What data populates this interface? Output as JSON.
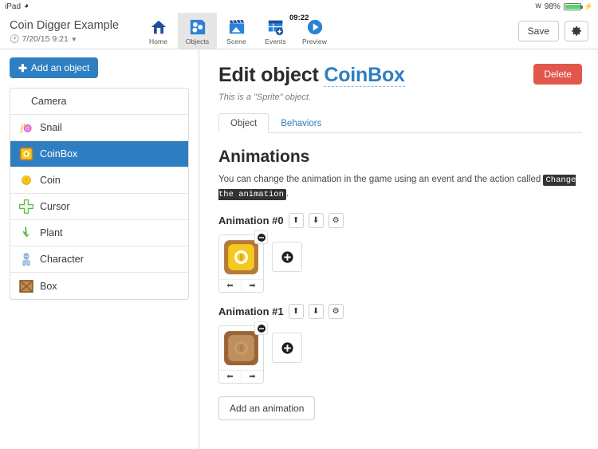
{
  "status_bar": {
    "device": "iPad",
    "wifi_icon": "wifi-icon",
    "bluetooth_icon": "bluetooth-icon",
    "battery_percent": "98%",
    "battery_level": 98,
    "charging_icon": "charging-bolt-icon"
  },
  "topbar": {
    "project_title": "Coin Digger Example",
    "project_date": "7/20/15 9:21",
    "clock_icon": "clock-icon",
    "dropdown_icon": "chevron-down-icon",
    "time": "09:22",
    "save_label": "Save",
    "settings_icon": "gear-icon",
    "tabs": [
      {
        "label": "Home",
        "icon": "home-icon",
        "active": false
      },
      {
        "label": "Objects",
        "icon": "objects-icon",
        "active": true
      },
      {
        "label": "Scene",
        "icon": "scene-clapperboard-icon",
        "active": false
      },
      {
        "label": "Events",
        "icon": "events-icon",
        "active": false
      },
      {
        "label": "Preview",
        "icon": "play-icon",
        "active": false
      }
    ]
  },
  "sidebar": {
    "add_object_label": "Add an object",
    "add_icon": "plus-icon",
    "items": [
      {
        "label": "Camera",
        "icon": "none",
        "selected": false
      },
      {
        "label": "Snail",
        "icon": "snail-icon",
        "selected": false
      },
      {
        "label": "CoinBox",
        "icon": "coinbox-icon",
        "selected": true
      },
      {
        "label": "Coin",
        "icon": "coin-icon",
        "selected": false
      },
      {
        "label": "Cursor",
        "icon": "cursor-cross-icon",
        "selected": false
      },
      {
        "label": "Plant",
        "icon": "plant-icon",
        "selected": false
      },
      {
        "label": "Character",
        "icon": "character-icon",
        "selected": false
      },
      {
        "label": "Box",
        "icon": "box-icon",
        "selected": false
      }
    ]
  },
  "main": {
    "title_prefix": "Edit object ",
    "object_name": "CoinBox",
    "delete_label": "Delete",
    "sprite_note": "This is a \"Sprite\" object.",
    "tabs": [
      {
        "label": "Object",
        "active": true
      },
      {
        "label": "Behaviors",
        "active": false
      }
    ],
    "animations_heading": "Animations",
    "description_before": "You can change the animation in the game using an event and the action called ",
    "description_code": "Change the animation",
    "description_after": ".",
    "move_up_icon": "arrow-up-icon",
    "move_down_icon": "arrow-down-icon",
    "settings_icon": "gear-icon",
    "remove_icon": "remove-circle-icon",
    "add_frame_icon": "plus-circle-icon",
    "frame_prev_icon": "arrow-left-icon",
    "frame_next_icon": "arrow-right-icon",
    "animations": [
      {
        "label": "Animation #0",
        "sprite": "coinbox-gold"
      },
      {
        "label": "Animation #1",
        "sprite": "coinbox-brown"
      }
    ],
    "add_animation_label": "Add an animation"
  },
  "colors": {
    "accent_blue": "#2e7fc1",
    "delete_red": "#e2574c",
    "battery_green": "#4cd964",
    "code_bg": "#333333"
  }
}
